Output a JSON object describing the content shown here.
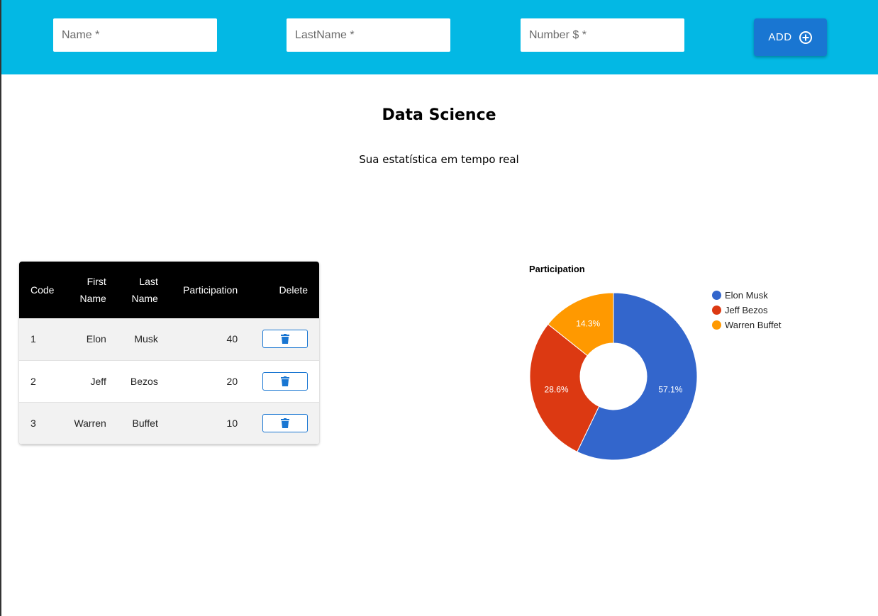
{
  "form": {
    "name_placeholder": "Name *",
    "lastname_placeholder": "LastName *",
    "number_placeholder": "Number $ *",
    "add_label": "ADD"
  },
  "page": {
    "title": "Data Science",
    "subtitle": "Sua estatística em tempo real"
  },
  "table": {
    "headers": {
      "code": "Code",
      "first_name_1": "First",
      "first_name_2": "Name",
      "last_name_1": "Last",
      "last_name_2": "Name",
      "participation": "Participation",
      "delete": "Delete"
    },
    "rows": [
      {
        "code": "1",
        "first": "Elon",
        "last": "Musk",
        "participation": "40"
      },
      {
        "code": "2",
        "first": "Jeff",
        "last": "Bezos",
        "participation": "20"
      },
      {
        "code": "3",
        "first": "Warren",
        "last": "Buffet",
        "participation": "10"
      }
    ]
  },
  "colors": {
    "header_bg": "#03b8e4",
    "accent": "#1976d2",
    "series": [
      "#3366cc",
      "#dc3912",
      "#ff9900"
    ]
  },
  "icons": {
    "add": "add-circle-outline-icon",
    "delete": "trash-icon"
  },
  "chart_data": {
    "type": "pie",
    "donut": true,
    "title": "Participation",
    "categories": [
      "Elon Musk",
      "Jeff Bezos",
      "Warren Buffet"
    ],
    "values": [
      40,
      20,
      10
    ],
    "labels": [
      "57.1%",
      "28.6%",
      "14.3%"
    ],
    "legend": "right"
  }
}
